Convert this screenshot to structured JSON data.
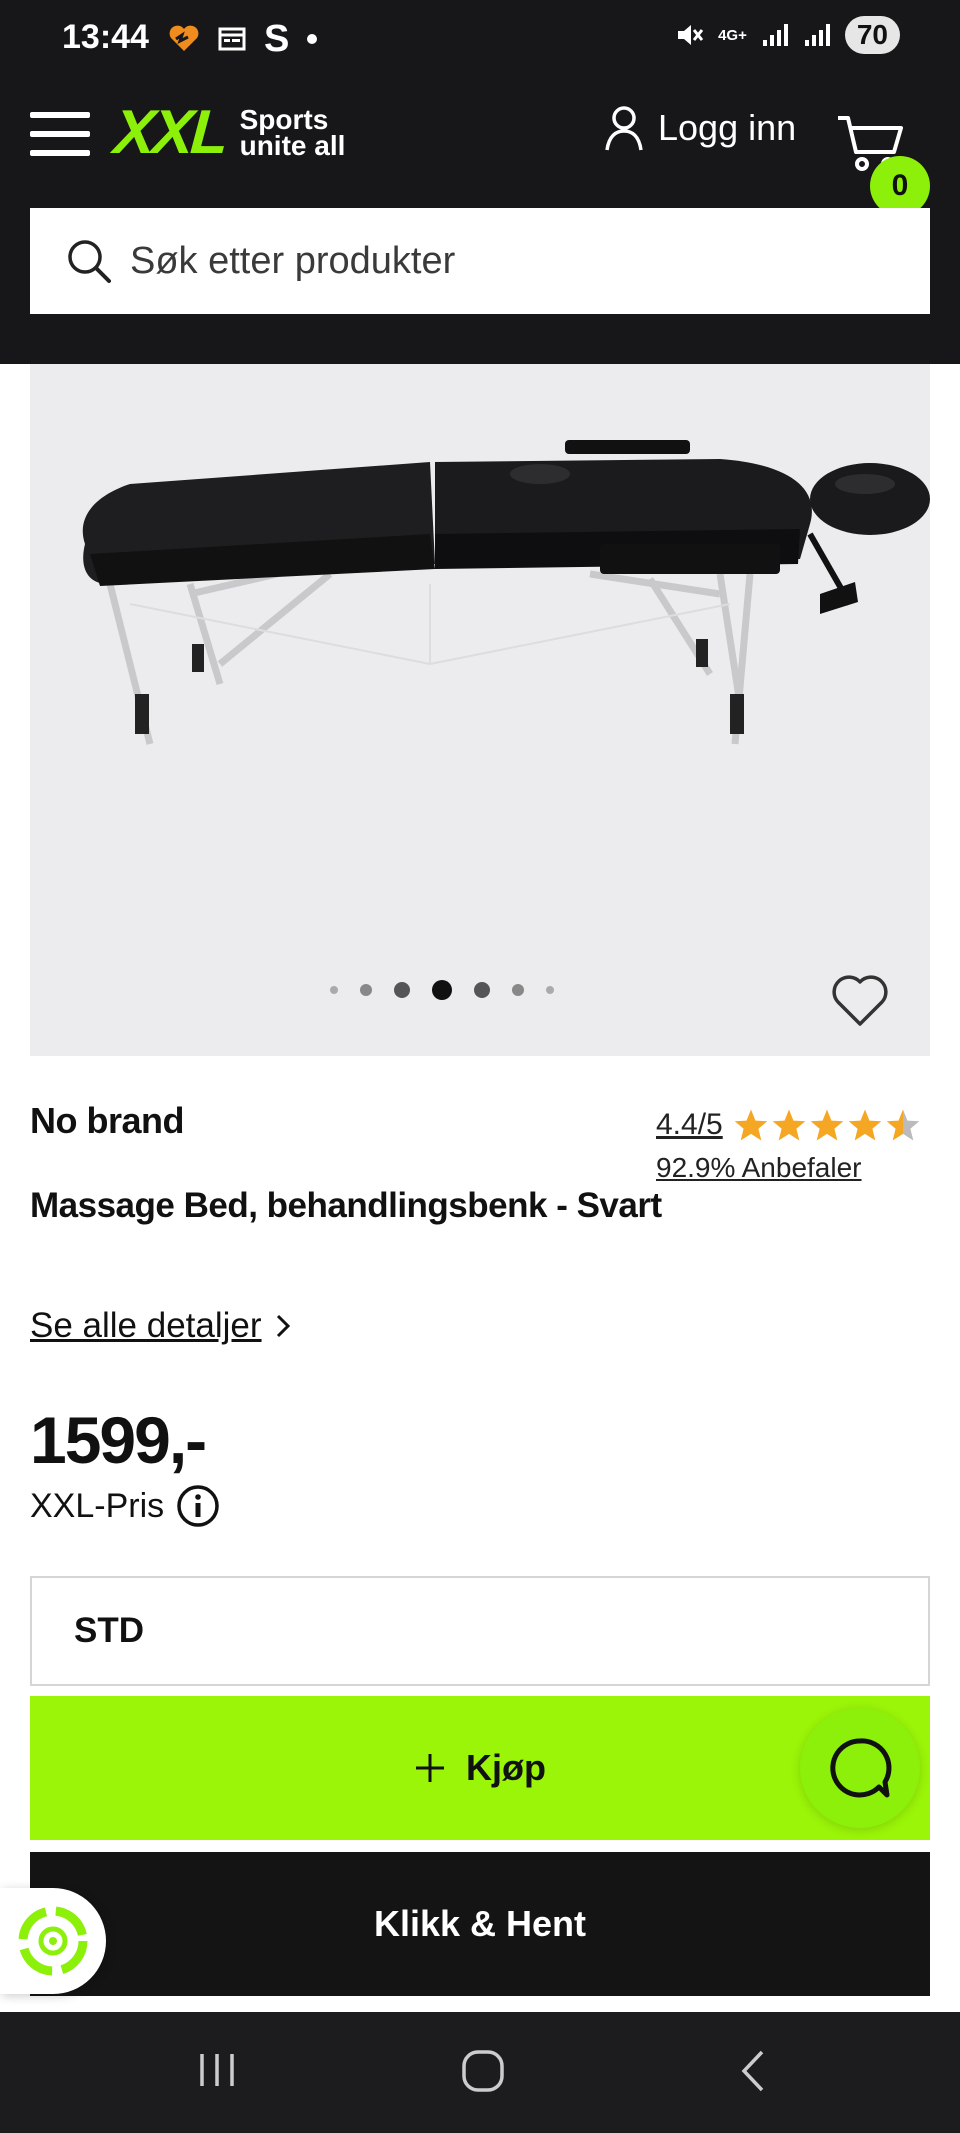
{
  "status_bar": {
    "time": "13:44",
    "s_icon": "S",
    "network": "4G+",
    "battery": "70",
    "icons": [
      "heart-app-icon",
      "calendar-icon",
      "mute-icon",
      "signal-icon"
    ]
  },
  "header": {
    "logo_text": "XXL",
    "logo_tagline_1": "Sports",
    "logo_tagline_2": "unite all",
    "login_label": "Logg inn",
    "cart_count": "0",
    "search_placeholder": "Søk etter produkter",
    "accent_color": "#8cf00a",
    "background_color": "#17171a"
  },
  "gallery": {
    "image_count": 7,
    "active_index": 3,
    "image_description_icon": "massage-table-image"
  },
  "product": {
    "brand": "No brand",
    "rating": "4.4/5",
    "rating_value": 4.4,
    "rating_max": 5,
    "recommend": "92.9% Anbefaler",
    "title": "Massage Bed, behandlingsbenk - Svart",
    "details_link": "Se alle detaljer",
    "price": "1599,-",
    "price_label": "XXL-Pris",
    "variant": "STD"
  },
  "actions": {
    "buy_label": "Kjøp",
    "collect_label": "Klikk & Hent",
    "buy_color": "#9af508",
    "collect_color": "#141414"
  }
}
